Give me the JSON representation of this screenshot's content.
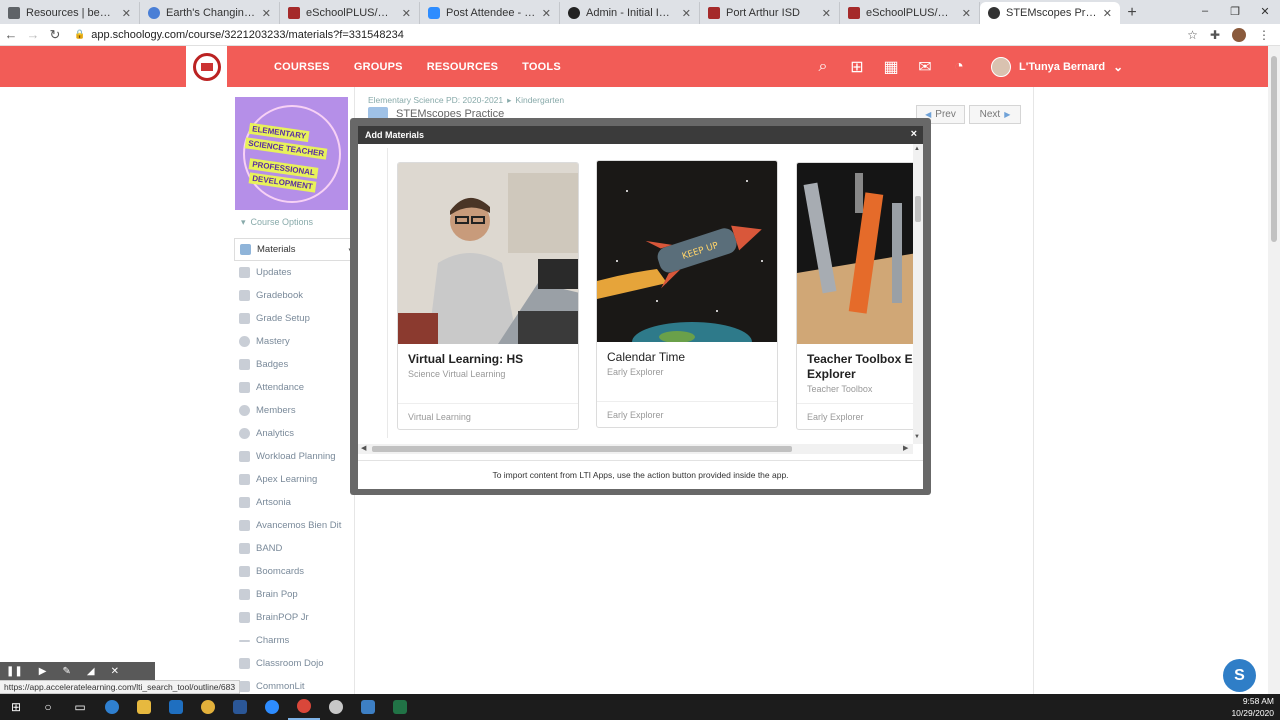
{
  "browser": {
    "tabs": [
      {
        "label": "Resources | beaumontcm",
        "color": "#5f6368"
      },
      {
        "label": "Earth's Changing Surfaces",
        "color": "#4a7fd6"
      },
      {
        "label": "eSchoolPLUS/Schoology – …",
        "color": "#a52a2a"
      },
      {
        "label": "Post Attendee - Zoom",
        "color": "#2d8cff"
      },
      {
        "label": "Admin - Initial Implementati…",
        "color": "#222222"
      },
      {
        "label": "Port Arthur ISD",
        "color": "#a52a2a"
      },
      {
        "label": "eSchoolPLUS/Schoology – …",
        "color": "#a52a2a"
      },
      {
        "label": "STEMscopes Practice | Scho…",
        "color": "#333333",
        "active": true
      }
    ],
    "url": "app.schoology.com/course/3221203233/materials?f=331548234",
    "window_controls": {
      "minimize": "–",
      "restore": "❐",
      "close": "✕"
    }
  },
  "header": {
    "nav": [
      "COURSES",
      "GROUPS",
      "RESOURCES",
      "TOOLS"
    ],
    "user_name": "L'Tunya Bernard",
    "brand_color": "#f25c57"
  },
  "sidebar": {
    "banner_lines": [
      "ELEMENTARY",
      "SCIENCE TEACHER",
      "PROFESSIONAL",
      "DEVELOPMENT"
    ],
    "course_options": "Course Options",
    "items": [
      "Materials",
      "Updates",
      "Gradebook",
      "Grade Setup",
      "Mastery",
      "Badges",
      "Attendance",
      "Members",
      "Analytics",
      "Workload Planning",
      "Apex Learning",
      "Artsonia",
      "Avancemos Bien Dit",
      "BAND",
      "Boomcards",
      "Brain Pop",
      "BrainPOP Jr",
      "Charms",
      "Classroom Dojo",
      "CommonLit"
    ]
  },
  "page": {
    "breadcrumb": [
      "Elementary Science PD: 2020-2021",
      "▸",
      "Kindergarten"
    ],
    "title": "STEMscopes Practice",
    "prev": "Prev",
    "next": "Next"
  },
  "modal": {
    "title": "Add Materials",
    "close": "×",
    "footer": "To import content from LTI Apps, use the action button provided inside the app.",
    "cards": [
      {
        "title": "Virtual Learning: HS",
        "subtitle": "Science Virtual Learning",
        "footer": "Virtual Learning"
      },
      {
        "title": "Calendar Time",
        "subtitle": "Early Explorer",
        "footer": "Early Explorer"
      },
      {
        "title": "Teacher Toolbox Ear Explorer",
        "subtitle": "Teacher Toolbox",
        "footer": "Early Explorer"
      }
    ]
  },
  "status_url": "https://app.acceleratelearning.com/lti_search_tool/outline/683",
  "chat_button": "S",
  "taskbar": {
    "time": "9:58 AM",
    "date": "10/29/2020"
  }
}
